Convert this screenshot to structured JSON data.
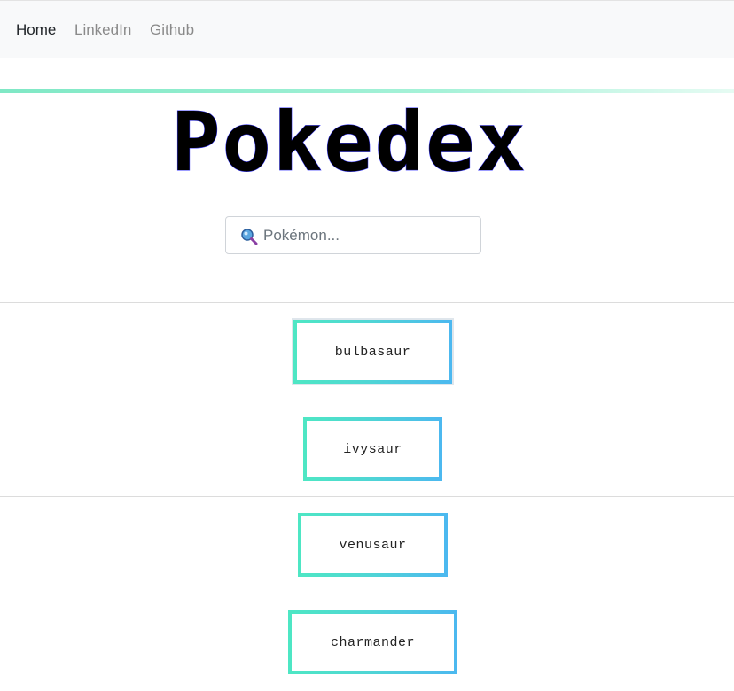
{
  "navbar": {
    "links": [
      {
        "label": "Home",
        "active": true
      },
      {
        "label": "LinkedIn",
        "active": false
      },
      {
        "label": "Github",
        "active": false
      }
    ]
  },
  "logo": {
    "text": "Pokedex"
  },
  "search": {
    "placeholder": "Pokémon...",
    "value": "",
    "icon": "magnifier-icon"
  },
  "pokemon_list": [
    {
      "name": "bulbasaur",
      "selected": true
    },
    {
      "name": "ivysaur",
      "selected": false
    },
    {
      "name": "venusaur",
      "selected": false
    },
    {
      "name": "charmander",
      "selected": false
    }
  ],
  "colors": {
    "card_gradient_start": "#4ee7c4",
    "card_gradient_end": "#4cb8f0",
    "accent_line": "#7fe8c5",
    "navbar_bg": "#f8f9fa"
  }
}
